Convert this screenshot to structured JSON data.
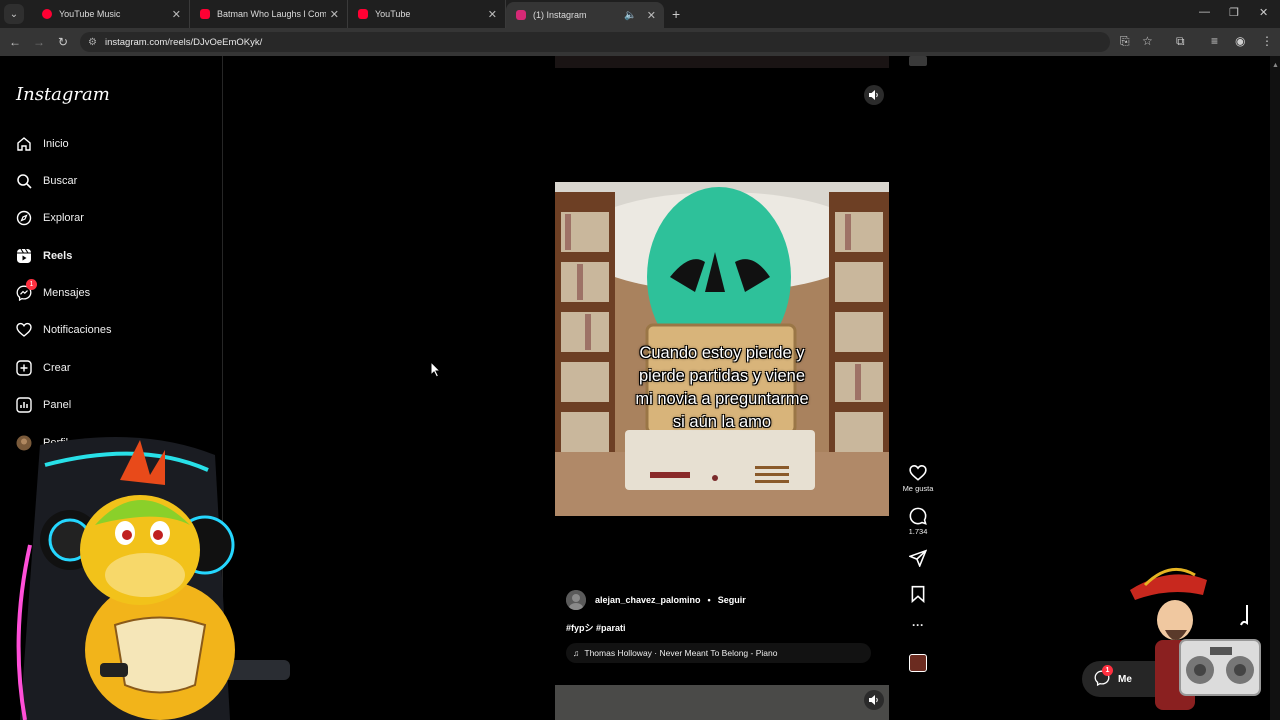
{
  "browser": {
    "tabs": [
      {
        "title": "YouTube Music",
        "color": "#ff0033",
        "active": false
      },
      {
        "title": "Batman Who Laughs l Comic N",
        "color": "#ff0033",
        "active": false
      },
      {
        "title": "YouTube",
        "color": "#ff0033",
        "active": false
      },
      {
        "title": "(1) Instagram",
        "color": "#d62976",
        "active": true
      }
    ],
    "url": "instagram.com/reels/DJvOeEmOKyk/"
  },
  "instagram": {
    "logo": "Instagram",
    "nav": [
      {
        "label": "Inicio",
        "icon": "home-icon"
      },
      {
        "label": "Buscar",
        "icon": "search-icon"
      },
      {
        "label": "Explorar",
        "icon": "compass-icon"
      },
      {
        "label": "Reels",
        "icon": "reels-icon"
      },
      {
        "label": "Mensajes",
        "icon": "messenger-icon",
        "badge": "1"
      },
      {
        "label": "Notificaciones",
        "icon": "heart-icon"
      },
      {
        "label": "Crear",
        "icon": "plus-square-icon"
      },
      {
        "label": "Panel",
        "icon": "chart-icon"
      },
      {
        "label": "Perfil",
        "icon": "avatar-icon"
      }
    ],
    "reel": {
      "caption_lines": [
        "Cuando estoy pierde y",
        "pierde partidas y viene",
        "mi novia a preguntarme",
        "si aún la amo"
      ],
      "like_label": "Me gusta",
      "comment_count": "1.734",
      "author": "alejan_chavez_palomino",
      "separator": "•",
      "follow": "Seguir",
      "hashtags": "#fypシ #parati",
      "music": "Thomas Holloway · Never Meant To Belong - Piano"
    },
    "messages_pill": {
      "label": "Me",
      "badge": "1"
    }
  },
  "colors": {
    "accent": "#ff3040",
    "bg": "#000000"
  }
}
